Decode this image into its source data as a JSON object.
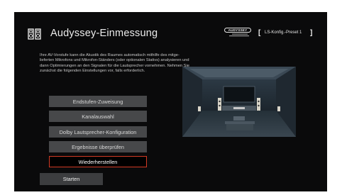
{
  "header": {
    "title": "Audyssey-Einmessung",
    "title_icon": "speaker-setup-icon",
    "logo_text": "AUDYSSEY",
    "preset_open": "[",
    "preset_label": "LS-Konfig.-Preset 1",
    "preset_close": "]"
  },
  "description": "Ihre AV-Vorstufe kann die Akustik des Raumes automatisch mithilfe des mitge- lieferten Mikrofons und Mikrofon-Ständers (oder optionalen Stativs) analysieren und dann Optimierungen an den Signalen für die Lautsprecher vornehmen. Nehmen Sie zunächst die folgenden Einstellungen vor, falls erforderlich.",
  "menu": [
    {
      "label": "Endstufen-Zuweisung"
    },
    {
      "label": "Kanalauswahl"
    },
    {
      "label": "Dolby Lautsprecher-Konfiguration"
    },
    {
      "label": "Ergebnisse überprüfen"
    },
    {
      "label": "Wiederherstellen",
      "selected": true
    }
  ],
  "start_button": "Starten",
  "colors": {
    "screen_bg": "#0a0a0b",
    "button_bg": "#47484a",
    "selection_border": "#d23a24"
  }
}
